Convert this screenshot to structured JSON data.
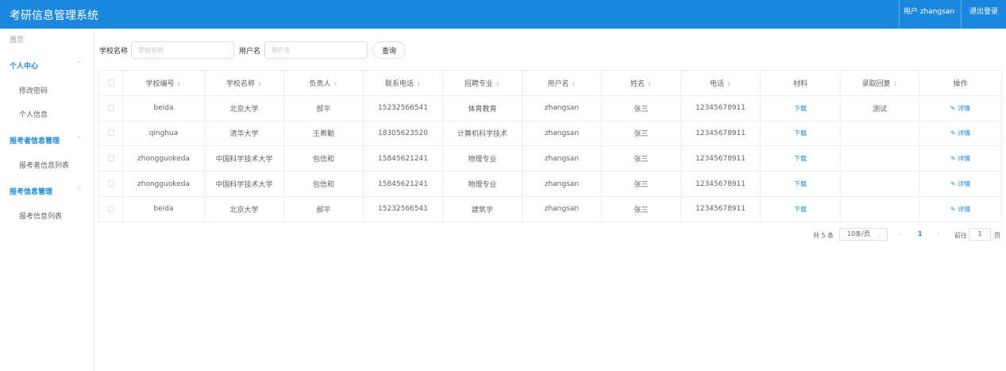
{
  "header": {
    "title": "考研信息管理系统",
    "user": "用户 zhangsan",
    "logout": "退出登录"
  },
  "sidebar": {
    "home": "首页",
    "groups": [
      {
        "label": "个人中心",
        "items": [
          "修改密码",
          "个人信息"
        ]
      },
      {
        "label": "报考者信息管理",
        "items": [
          "报考者信息列表"
        ]
      },
      {
        "label": "报考信息管理",
        "items": [
          "报考信息列表"
        ]
      }
    ]
  },
  "search": {
    "school_label": "学校名称",
    "school_placeholder": "学校名称",
    "user_label": "用户名",
    "user_placeholder": "用户名",
    "query_button": "查询"
  },
  "table": {
    "headers": [
      "学校编号",
      "学校名称",
      "负责人",
      "联系电话",
      "招聘专业",
      "用户名",
      "姓名",
      "电话",
      "材料",
      "录取回复",
      "操作"
    ],
    "download_label": "下载",
    "detail_label": "详情",
    "rows": [
      [
        "beida",
        "北京大学",
        "郝平",
        "15232566541",
        "体育教育",
        "zhangsan",
        "张三",
        "12345678911",
        "下载",
        "测试",
        "详情"
      ],
      [
        "qinghua",
        "清华大学",
        "王希勤",
        "18305623520",
        "计算机科学技术",
        "zhangsan",
        "张三",
        "12345678911",
        "下载",
        "",
        "详情"
      ],
      [
        "zhongguokeda",
        "中国科学技术大学",
        "包信和",
        "15845621241",
        "物理专业",
        "zhangsan",
        "张三",
        "12345678911",
        "下载",
        "",
        "详情"
      ],
      [
        "zhongguokeda",
        "中国科学技术大学",
        "包信和",
        "15845621241",
        "物理专业",
        "zhangsan",
        "张三",
        "12345678911",
        "下载",
        "",
        "详情"
      ],
      [
        "beida",
        "北京大学",
        "郝平",
        "15232566541",
        "建筑学",
        "zhangsan",
        "张三",
        "12345678911",
        "下载",
        "",
        "详情"
      ]
    ]
  },
  "pagination": {
    "total": "共 5 条",
    "page_size": "10条/页",
    "current": "1",
    "goto_label": "前往",
    "goto_value": "1",
    "page_suffix": "页"
  },
  "colors": {
    "primary": "#1b88e0",
    "border": "#ebeef5",
    "text": "#606266"
  }
}
